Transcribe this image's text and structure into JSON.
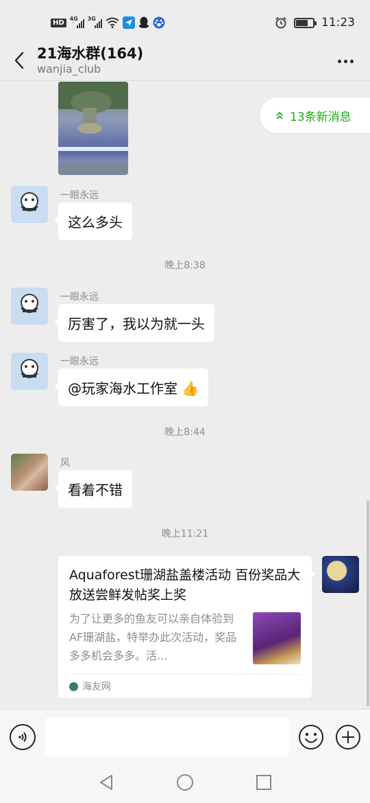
{
  "status_bar": {
    "hd_badge": "HD",
    "sim1_label": "4G",
    "sim2_label": "3G",
    "time": "11:23",
    "battery_percent": 70,
    "icons": [
      "hd-icon",
      "signal-icon",
      "signal-icon",
      "wifi-icon",
      "app-notification-icon",
      "qq-icon",
      "baidu-icon",
      "alarm-icon",
      "battery-icon"
    ]
  },
  "header": {
    "title": "21海水群(164)",
    "subtitle": "wanjia_club",
    "back_icon": "back-arrow-icon",
    "more_icon": "more-icon"
  },
  "new_messages": {
    "label": "13条新消息",
    "icon": "double-chevron-up-icon",
    "color": "#1aad19"
  },
  "messages": [
    {
      "sender": "一眼永远",
      "text": "这么多头"
    },
    {
      "time": "晚上8:38"
    },
    {
      "sender": "一眼永远",
      "text": "厉害了，我以为就一头"
    },
    {
      "sender": "一眼永远",
      "text": "@玩家海水工作室 👍"
    },
    {
      "time": "晚上8:44"
    },
    {
      "sender": "风",
      "text": "看着不错"
    },
    {
      "time": "晚上11:21"
    }
  ],
  "link_card": {
    "title": "Aquaforest珊湖盐盖楼活动 百份奖品大放送尝鲜发帖奖上奖",
    "description": "为了让更多的鱼友可以亲自体验到AF珊湖盐，特举办此次活动，奖品多多机会多多。活...",
    "source": "海友网"
  },
  "input_bar": {
    "placeholder": "",
    "voice_icon": "voice-icon",
    "emoji_icon": "emoji-icon",
    "plus_icon": "plus-icon"
  },
  "system_nav": {
    "icons": [
      "nav-back-icon",
      "nav-home-icon",
      "nav-recents-icon"
    ]
  }
}
